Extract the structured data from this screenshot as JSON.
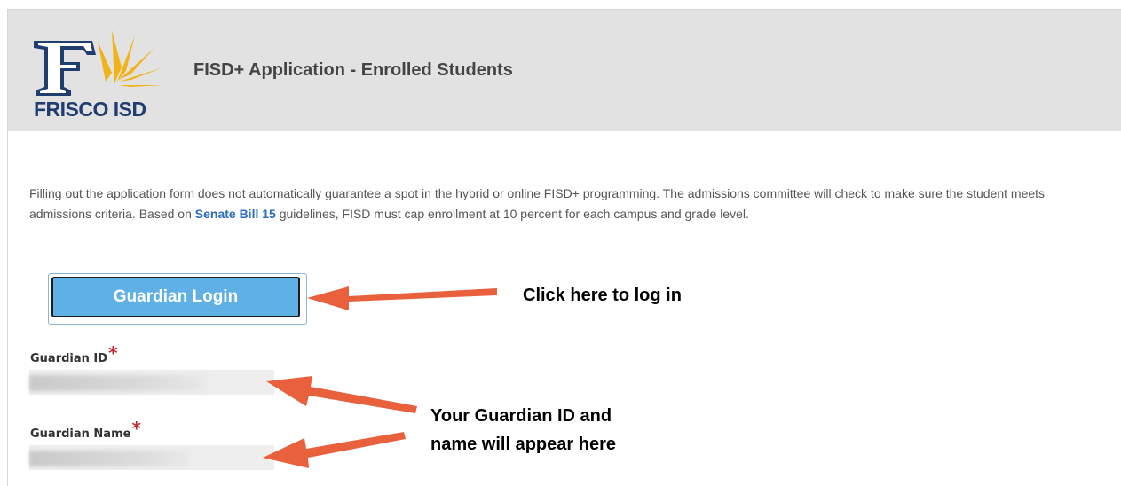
{
  "header": {
    "logo_text": "FRISCO ISD",
    "title": "FISD+ Application - Enrolled Students"
  },
  "intro": {
    "text_before": "Filling out the application form does not automatically guarantee a spot in the hybrid or online FISD+ programming. The admissions committee will check to make sure the student meets admissions criteria. Based on ",
    "link_text": "Senate Bill 15",
    "text_after": " guidelines, FISD must cap enrollment at 10 percent for each campus and grade level."
  },
  "login": {
    "button_label": "Guardian Login"
  },
  "fields": {
    "guardian_id_label": "Guardian ID",
    "guardian_name_label": "Guardian Name",
    "required_marker": "*"
  },
  "annotations": {
    "click_here": "Click here to log in",
    "appear_line1": "Your Guardian ID and",
    "appear_line2": "name will appear here"
  },
  "colors": {
    "header_bg": "#e2e2e2",
    "button_bg": "#5eb0e5",
    "link": "#2a6ebb",
    "required": "#c0282d",
    "arrow": "#e8613c",
    "logo_navy": "#1f3d6e",
    "logo_gold": "#f2b21a"
  }
}
